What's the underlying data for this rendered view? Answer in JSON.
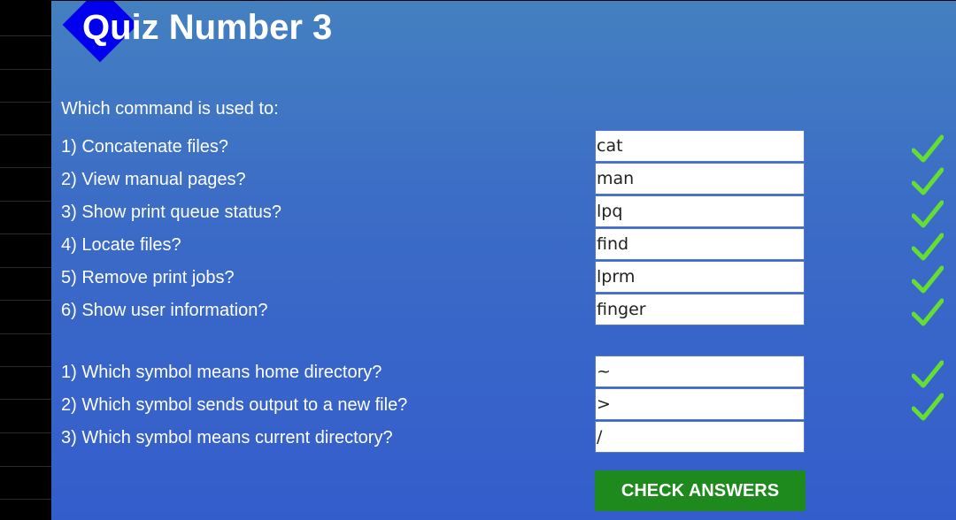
{
  "title": "Quiz Number 3",
  "intro": "Which command is used to:",
  "section1": [
    {
      "question": "1) Concatenate files?",
      "answer": "cat",
      "correct": true
    },
    {
      "question": "2) View manual pages?",
      "answer": "man",
      "correct": true
    },
    {
      "question": "3) Show print queue status?",
      "answer": "lpq",
      "correct": true
    },
    {
      "question": "4) Locate files?",
      "answer": "find",
      "correct": true
    },
    {
      "question": "5) Remove print jobs?",
      "answer": "lprm",
      "correct": true
    },
    {
      "question": "6) Show user information?",
      "answer": "finger",
      "correct": true
    }
  ],
  "section2": [
    {
      "question": "1) Which symbol means home directory?",
      "answer": "~",
      "correct": true
    },
    {
      "question": "2) Which symbol sends output to a new file?",
      "answer": ">",
      "correct": true
    },
    {
      "question": "3) Which symbol means current directory?",
      "answer": "/",
      "correct": false
    }
  ],
  "check_button_label": "CHECK ANSWERS",
  "colors": {
    "check_mark": "#66dd33",
    "button": "#1e8a1e",
    "diamond": "#0000ee"
  },
  "icons": {
    "check": "check-mark-icon"
  }
}
